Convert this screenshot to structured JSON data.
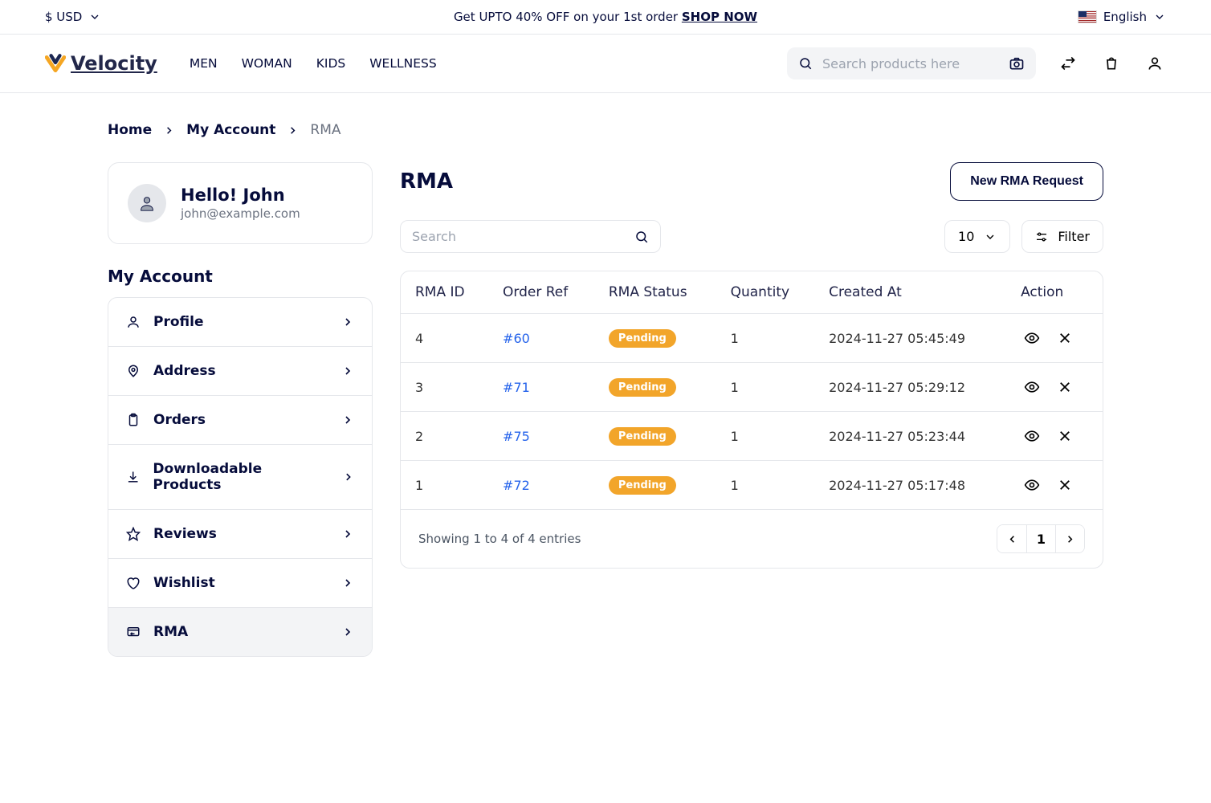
{
  "topbar": {
    "currency": "$ USD",
    "promo_text": "Get UPTO 40% OFF on your 1st order ",
    "promo_cta": "SHOP NOW",
    "language": "English"
  },
  "header": {
    "brand": "Velocity",
    "nav": {
      "men": "MEN",
      "woman": "WOMAN",
      "kids": "KIDS",
      "wellness": "WELLNESS"
    },
    "search_placeholder": "Search products here"
  },
  "breadcrumbs": {
    "home": "Home",
    "account": "My Account",
    "current": "RMA"
  },
  "sidebar": {
    "greeting": "Hello! John",
    "email": "john@example.com",
    "heading": "My Account",
    "items": [
      {
        "label": "Profile"
      },
      {
        "label": "Address"
      },
      {
        "label": "Orders"
      },
      {
        "label": "Downloadable Products"
      },
      {
        "label": "Reviews"
      },
      {
        "label": "Wishlist"
      },
      {
        "label": "RMA"
      }
    ]
  },
  "main": {
    "title": "RMA",
    "new_btn": "New RMA Request",
    "search_placeholder": "Search",
    "page_size": "10",
    "filter_label": "Filter",
    "columns": {
      "id": "RMA ID",
      "order": "Order Ref",
      "status": "RMA Status",
      "qty": "Quantity",
      "created": "Created At",
      "action": "Action"
    },
    "rows": [
      {
        "id": "4",
        "order": "#60",
        "status": "Pending",
        "qty": "1",
        "created": "2024-11-27 05:45:49"
      },
      {
        "id": "3",
        "order": "#71",
        "status": "Pending",
        "qty": "1",
        "created": "2024-11-27 05:29:12"
      },
      {
        "id": "2",
        "order": "#75",
        "status": "Pending",
        "qty": "1",
        "created": "2024-11-27 05:23:44"
      },
      {
        "id": "1",
        "order": "#72",
        "status": "Pending",
        "qty": "1",
        "created": "2024-11-27 05:17:48"
      }
    ],
    "footer_msg": "Showing 1 to 4 of 4 entries",
    "current_page": "1"
  }
}
